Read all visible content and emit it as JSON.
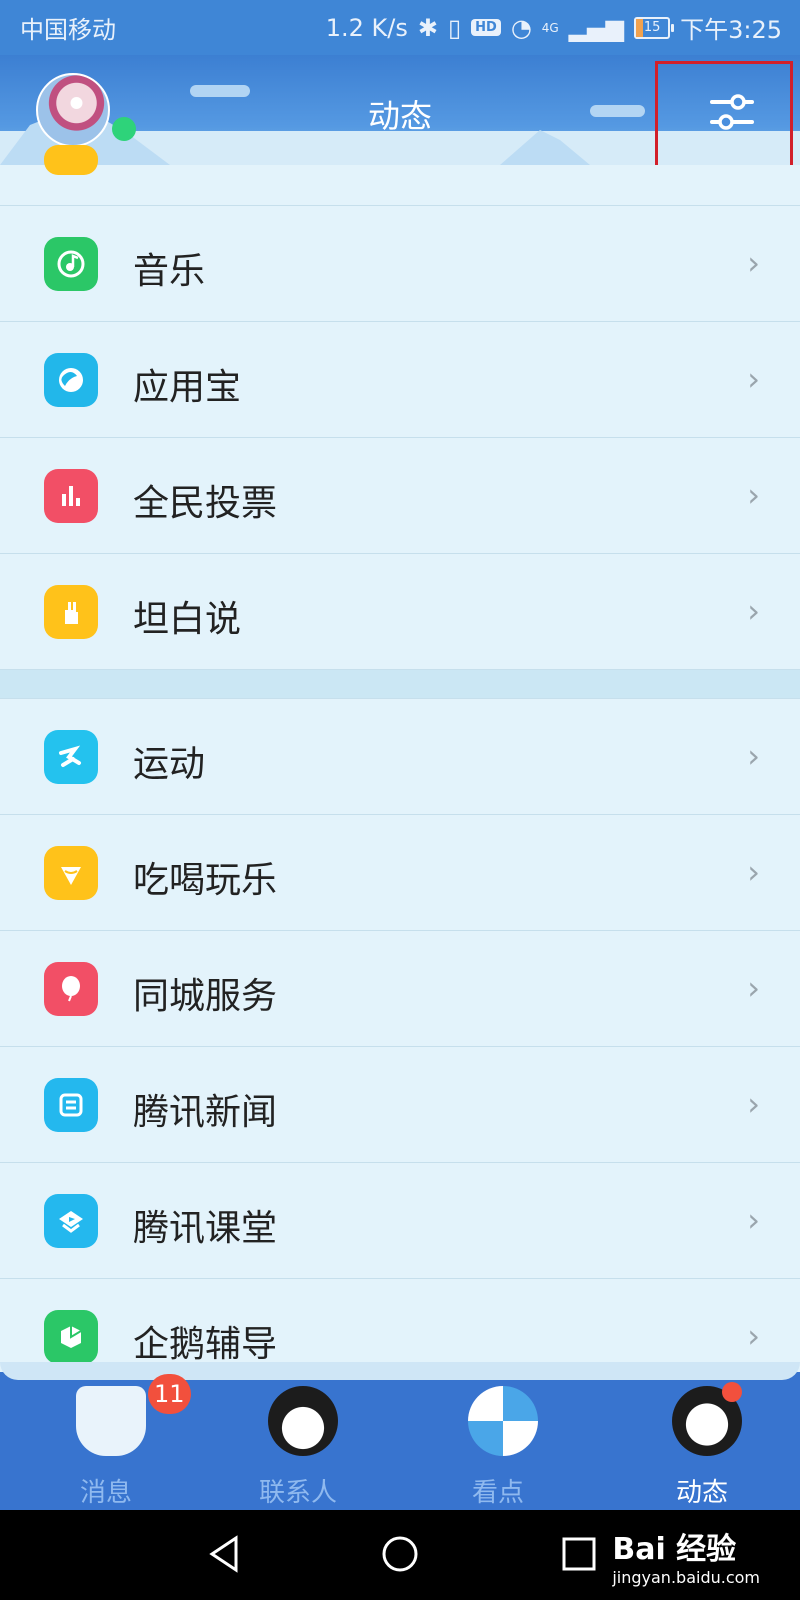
{
  "status_bar": {
    "carrier": "中国移动",
    "speed": "1.2 K/s",
    "hd": "HD",
    "network": "4G",
    "battery": "15",
    "time": "下午3:25"
  },
  "header": {
    "title": "动态"
  },
  "list": {
    "items": [
      {
        "label": "音乐",
        "color": "#2bc767"
      },
      {
        "label": "应用宝",
        "color": "#22b7ea"
      },
      {
        "label": "全民投票",
        "color": "#f24f66"
      },
      {
        "label": "坦白说",
        "color": "#ffc21a"
      }
    ],
    "items2": [
      {
        "label": "运动",
        "color": "#24c2ee"
      },
      {
        "label": "吃喝玩乐",
        "color": "#ffc21a"
      },
      {
        "label": "同城服务",
        "color": "#f24f66"
      },
      {
        "label": "腾讯新闻",
        "color": "#24b8ee"
      },
      {
        "label": "腾讯课堂",
        "color": "#24b8ee"
      },
      {
        "label": "企鹅辅导",
        "color": "#2bc767"
      }
    ]
  },
  "tabbar": {
    "messages": {
      "label": "消息",
      "badge": "11"
    },
    "contacts": {
      "label": "联系人"
    },
    "kandian": {
      "label": "看点"
    },
    "dongtai": {
      "label": "动态"
    }
  },
  "watermark": {
    "main": "Bai 经验",
    "sub": "jingyan.baidu.com"
  }
}
